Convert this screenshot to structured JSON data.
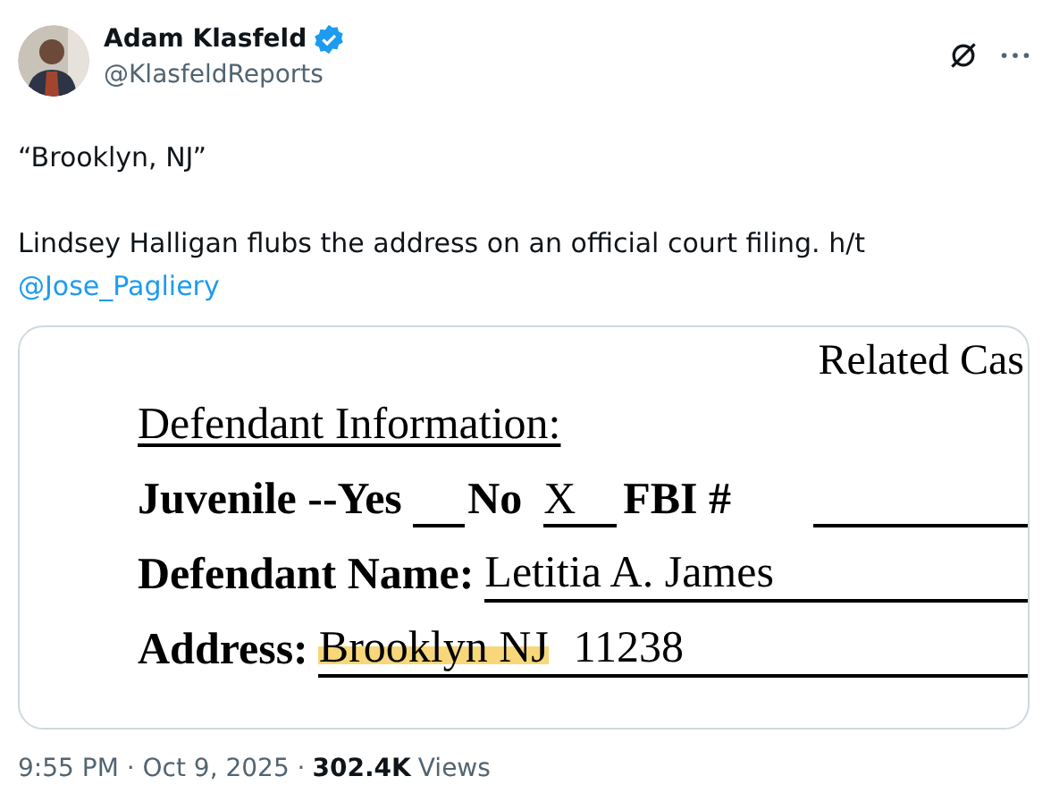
{
  "author": {
    "name": "Adam Klasfeld",
    "verified": true,
    "handle": "@KlasfeldReports"
  },
  "text": {
    "quote": "“Brooklyn, NJ”",
    "body": "Lindsey Halligan flubs the address on an official court filing. h/t",
    "mention": "@Jose_Pagliery"
  },
  "document": {
    "header": "Related Cas",
    "heading": "Defendant Information:",
    "rows": [
      {
        "kind": "checks",
        "parts": [
          {
            "kind": "label",
            "text": "Juvenile --Yes"
          },
          {
            "kind": "blank"
          },
          {
            "kind": "label",
            "text": "No"
          },
          {
            "kind": "filled",
            "text": "X"
          },
          {
            "kind": "label",
            "text": "FBI #"
          },
          {
            "kind": "line"
          }
        ]
      },
      {
        "kind": "field",
        "label": "Defendant Name:",
        "values": [
          {
            "text": "Letitia A. James",
            "highlighted": false
          }
        ]
      },
      {
        "kind": "field",
        "label": "Address:",
        "values": [
          {
            "text": "Brooklyn NJ",
            "highlighted": true
          },
          {
            "text": "11238",
            "highlighted": false
          }
        ]
      }
    ]
  },
  "footer": {
    "time": "9:55 PM · Oct 9, 2025 ·",
    "views_count": "302.4K",
    "views_label": "Views"
  }
}
